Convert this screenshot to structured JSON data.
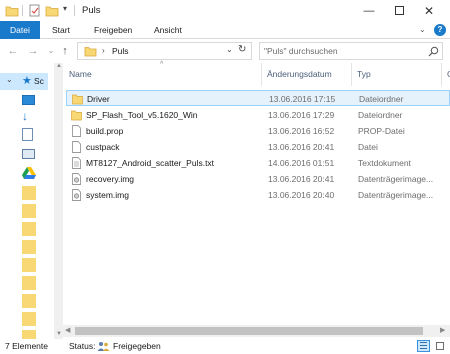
{
  "window": {
    "title": "Puls"
  },
  "ribbon": {
    "tabs": [
      "Datei",
      "Start",
      "Freigeben",
      "Ansicht"
    ],
    "help_icon": "help-icon"
  },
  "address": {
    "path": "Puls",
    "search_placeholder": "\"Puls\" durchsuchen"
  },
  "columns": {
    "name": "Name",
    "date": "Änderungsdatum",
    "type": "Typ",
    "size": "G"
  },
  "files": [
    {
      "name": "Driver",
      "date": "13.06.2016 17:15",
      "type": "Dateiordner",
      "icon": "folder-icon",
      "selected": true
    },
    {
      "name": "SP_Flash_Tool_v5.1620_Win",
      "date": "13.06.2016 17:29",
      "type": "Dateiordner",
      "icon": "folder-icon"
    },
    {
      "name": "build.prop",
      "date": "13.06.2016 16:52",
      "type": "PROP-Datei",
      "icon": "file-icon"
    },
    {
      "name": "custpack",
      "date": "13.06.2016 20:41",
      "type": "Datei",
      "icon": "file-icon"
    },
    {
      "name": "MT8127_Android_scatter_Puls.txt",
      "date": "14.06.2016 01:51",
      "type": "Textdokument",
      "icon": "text-file-icon"
    },
    {
      "name": "recovery.img",
      "date": "13.06.2016 20:41",
      "type": "Datenträgerimage...",
      "icon": "disk-image-icon"
    },
    {
      "name": "system.img",
      "date": "13.06.2016 20:40",
      "type": "Datenträgerimage...",
      "icon": "disk-image-icon"
    }
  ],
  "navpane": {
    "first_item_label": "Sc"
  },
  "status": {
    "count": "7 Elemente",
    "label": "Status:",
    "value": "Freigegeben"
  }
}
